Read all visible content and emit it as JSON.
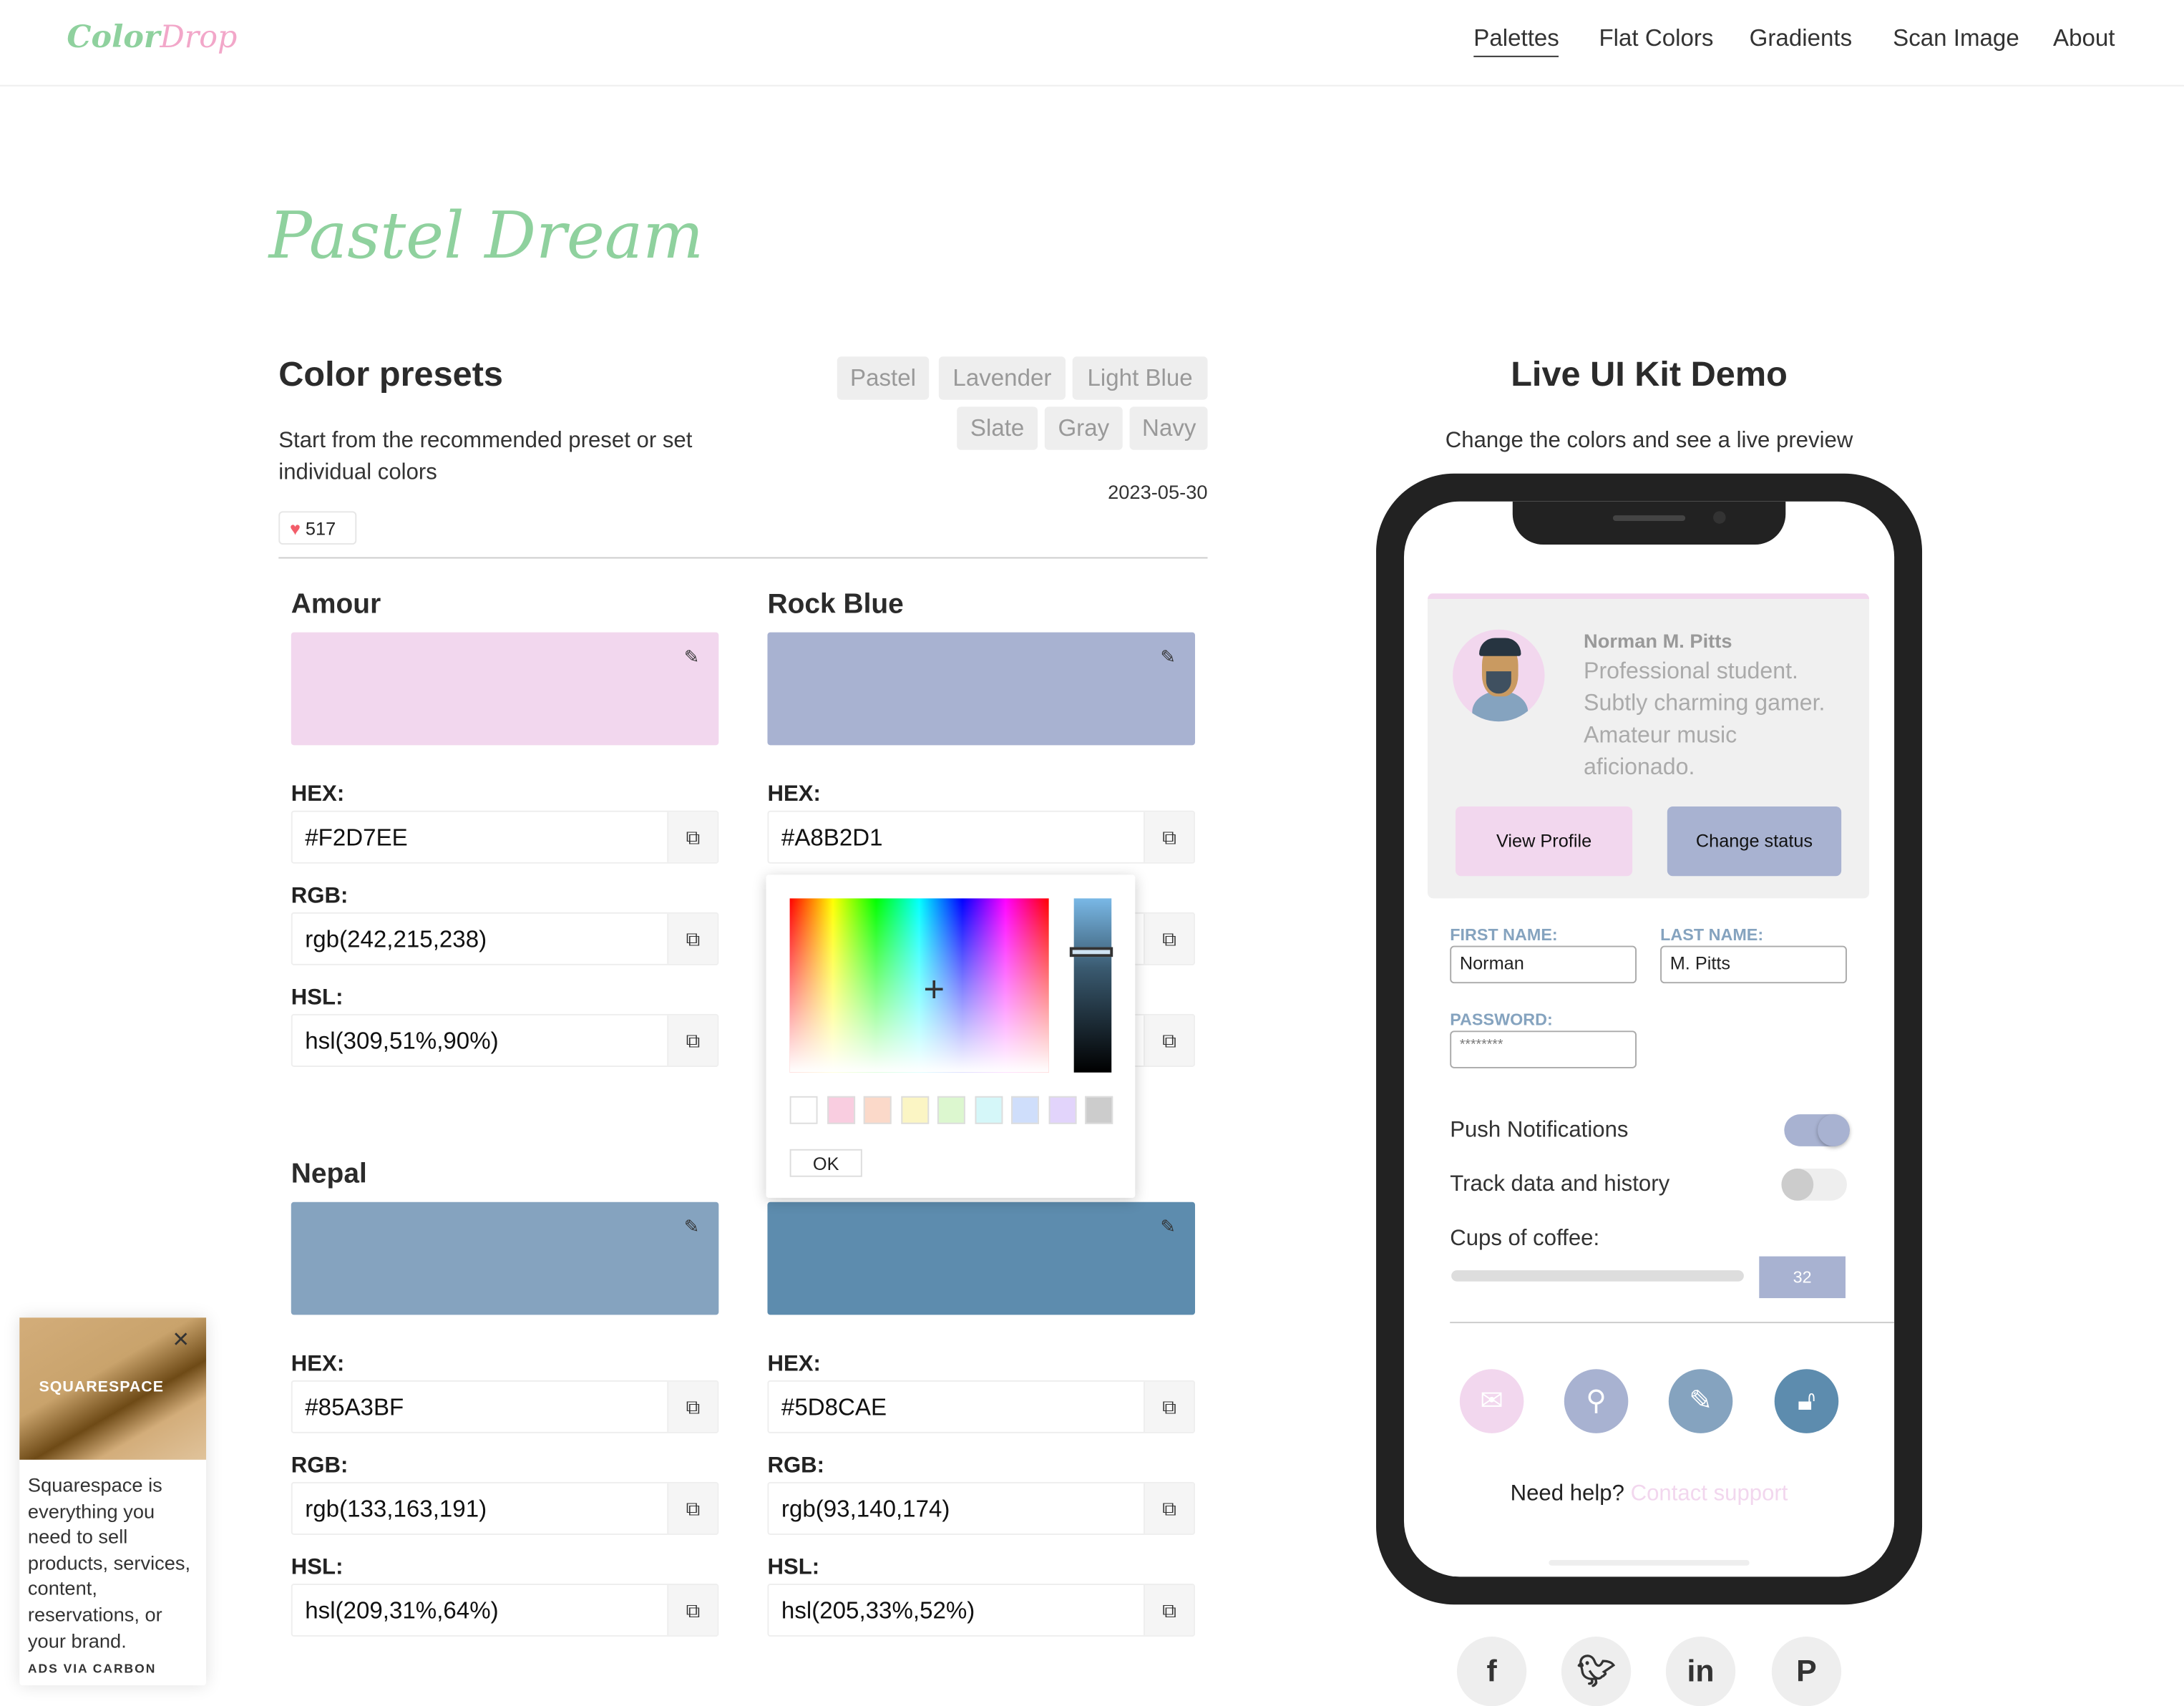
{
  "header": {
    "logo_a": "Color",
    "logo_b": "Drop",
    "nav": [
      "Palettes",
      "Flat Colors",
      "Gradients",
      "Scan Image",
      "About"
    ]
  },
  "page_title": "Pastel Dream",
  "presets": {
    "title": "Color presets",
    "description": "Start from the recommended preset or set individual colors",
    "tags": [
      "Pastel",
      "Lavender",
      "Light Blue",
      "Slate",
      "Gray",
      "Navy"
    ],
    "date": "2023-05-30",
    "likes": "517"
  },
  "labels": {
    "hex": "HEX:",
    "rgb": "RGB:",
    "hsl": "HSL:"
  },
  "colors": [
    {
      "name": "Amour",
      "hex": "#F2D7EE",
      "rgb": "rgb(242,215,238)",
      "hsl": "hsl(309,51%,90%)",
      "swatch": "#F2D7EE"
    },
    {
      "name": "Rock Blue",
      "hex": "#A8B2D1",
      "rgb": "",
      "hsl": "",
      "swatch": "#A8B2D1"
    },
    {
      "name": "Nepal",
      "hex": "#85A3BF",
      "rgb": "rgb(133,163,191)",
      "hsl": "hsl(209,31%,64%)",
      "swatch": "#85A3BF"
    },
    {
      "name": "",
      "hex": "#5D8CAE",
      "rgb": "rgb(93,140,174)",
      "hsl": "hsl(205,33%,52%)",
      "swatch": "#5D8CAE"
    }
  ],
  "picker": {
    "ok": "OK",
    "swatches": [
      "#ffffff",
      "#f9cde0",
      "#fbd9c9",
      "#fbf5c4",
      "#dcf7cf",
      "#d5f7f9",
      "#cfdefb",
      "#e2d4fb",
      "#cccccc"
    ]
  },
  "demo": {
    "title": "Live UI Kit Demo",
    "subtitle": "Change the colors and see a live preview",
    "profile_name": "Norman M. Pitts",
    "bio": "Professional student. Subtly charming gamer. Amateur music aficionado.",
    "view_profile": "View Profile",
    "change_status": "Change status",
    "first_name_label": "FIRST NAME:",
    "first_name": "Norman",
    "last_name_label": "LAST NAME:",
    "last_name": "M. Pitts",
    "password_label": "PASSWORD:",
    "password": "********",
    "push": "Push Notifications",
    "push_on": true,
    "track": "Track data and history",
    "track_on": false,
    "coffee": "Cups of coffee:",
    "coffee_value": "32",
    "help": "Need help?",
    "contact": "Contact support",
    "icons": [
      "mail-icon",
      "location-icon",
      "pencil-icon",
      "unlock-icon"
    ]
  },
  "social": [
    "facebook",
    "twitter",
    "linkedin",
    "pinterest"
  ],
  "ad": {
    "brand": "SQUARESPACE",
    "text": "Squarespace is everything you need to sell products, services, content, reservations, or your brand.",
    "footer": "ADS VIA CARBON"
  }
}
